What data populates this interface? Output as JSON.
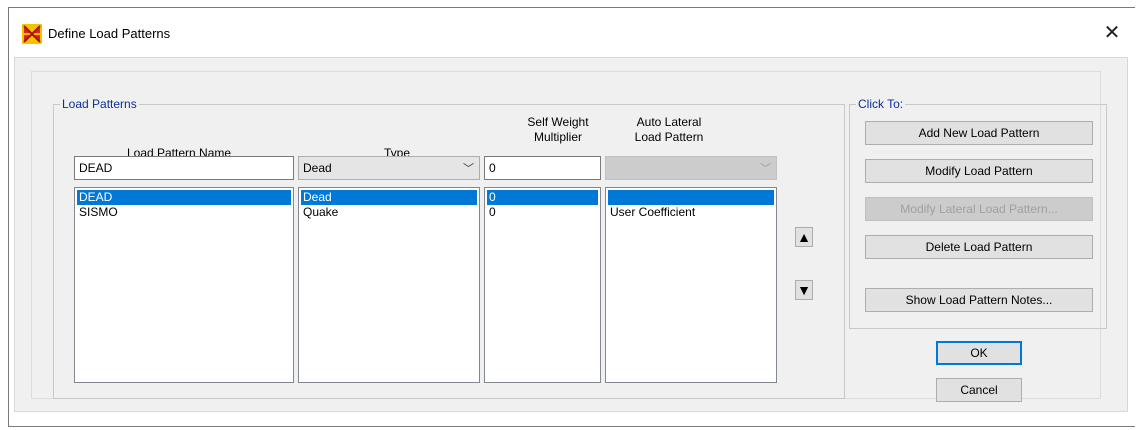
{
  "window": {
    "title": "Define Load Patterns",
    "close_label": "✕"
  },
  "load_patterns": {
    "group_label": "Load Patterns",
    "headers": {
      "name": "Load Pattern Name",
      "type": "Type",
      "self_weight": "Self Weight\nMultiplier",
      "auto_lateral": "Auto Lateral\nLoad Pattern"
    },
    "edit": {
      "name": "DEAD",
      "type": "Dead",
      "self_weight": "0",
      "auto_lateral": ""
    },
    "rows": [
      {
        "name": "DEAD",
        "type": "Dead",
        "self_weight": "0",
        "auto_lateral": ""
      },
      {
        "name": "SISMO",
        "type": "Quake",
        "self_weight": "0",
        "auto_lateral": "User Coefficient"
      }
    ],
    "selected_row": 0,
    "move_up": "▲",
    "move_down": "▼"
  },
  "click_to": {
    "group_label": "Click To:",
    "add": "Add New Load Pattern",
    "modify": "Modify Load Pattern",
    "modify_lateral": "Modify Lateral Load Pattern...",
    "delete": "Delete Load Pattern",
    "notes": "Show Load Pattern Notes..."
  },
  "buttons": {
    "ok": "OK",
    "cancel": "Cancel"
  },
  "colors": {
    "selection": "#0078d7",
    "group_label": "#0a2fa0",
    "dialog_bg": "#f0f0f0"
  }
}
